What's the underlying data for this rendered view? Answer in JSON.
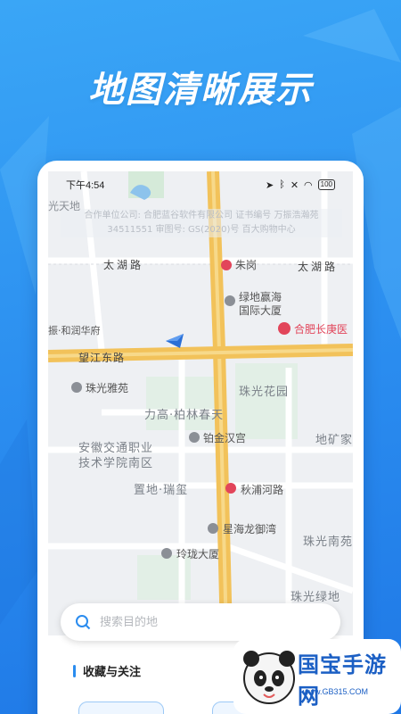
{
  "hero": {
    "title": "地图清晰展示"
  },
  "status_bar": {
    "time": "下午4:54",
    "battery": "100"
  },
  "map": {
    "watermark_line1": "合作单位公司: 合肥蓝谷软件有限公司   证书编号  万振浩瀚苑",
    "watermark_line2": "34511551  审图号: GS(2020)号  百大购物中心",
    "labels": {
      "guangtiandi": "光天地",
      "taihu_road_left": "太湖路",
      "taihu_road_right": "太湖路",
      "zhugang": "朱岗",
      "lvdi_line1": "绿地赢海",
      "lvdi_line2": "国际大厦",
      "hefei_hospital": "合肥长庚医",
      "zhenrunhua": "振·和润华府",
      "wangjiang_road": "望江东路",
      "zhuguang_yayuan": "珠光雅苑",
      "zhuguang_huayuan": "珠光花园",
      "ligao": "力高·柏林春天",
      "bojin": "铂金汉宫",
      "diku": "地矿家",
      "ahjt_line1": "安徽交通职业",
      "ahjt_line2": "技术学院南区",
      "zhidi": "置地·瑞玺",
      "qiupu": "秋浦河路",
      "xinghai": "星海龙御湾",
      "zhuguang_nanyuan": "珠光南苑",
      "linglong": "玲珑大厦",
      "zhuguang_lvdi": "珠光绿地",
      "baida": "百大购物中心"
    }
  },
  "search": {
    "placeholder": "搜索目的地"
  },
  "favorites": {
    "title": "收藏与关注"
  },
  "branding": {
    "name": "国宝手游网",
    "url": "www.GB315.COM"
  },
  "colors": {
    "accent": "#2a8cef",
    "road_major": "#f2c25a",
    "hospital": "#e2455a"
  }
}
